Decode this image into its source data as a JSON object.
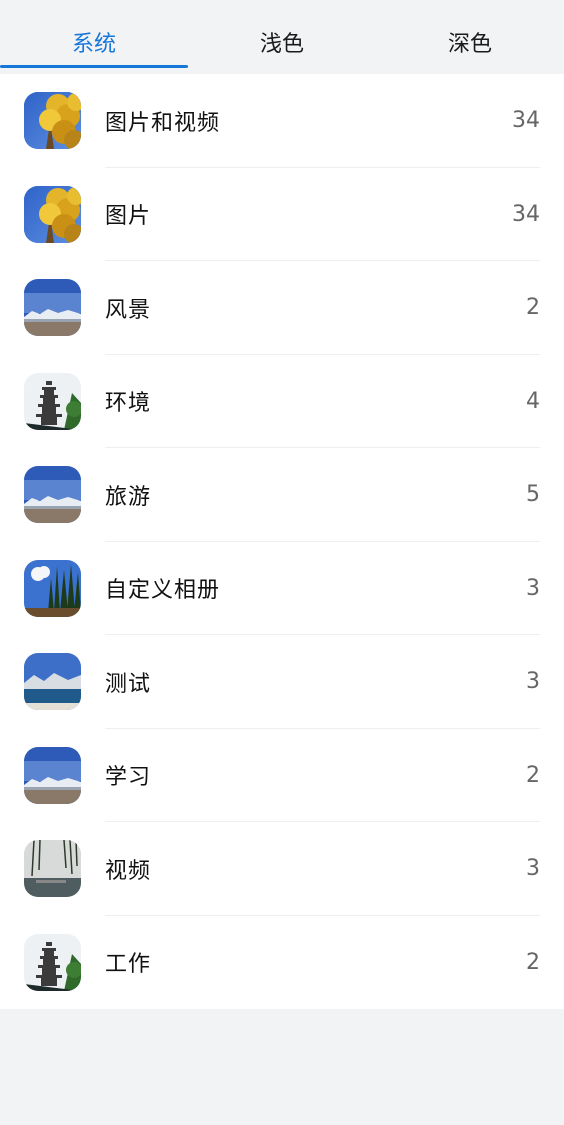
{
  "tabs": [
    {
      "label": "系统",
      "active": true
    },
    {
      "label": "浅色",
      "active": false
    },
    {
      "label": "深色",
      "active": false
    }
  ],
  "colors": {
    "accent": "#1677d9",
    "background": "#f1f3f5",
    "list_background": "#ffffff"
  },
  "albums": [
    {
      "name": "图片和视频",
      "count": "34",
      "thumb": "yellow-tree-sky"
    },
    {
      "name": "图片",
      "count": "34",
      "thumb": "yellow-tree-sky"
    },
    {
      "name": "风景",
      "count": "2",
      "thumb": "snow-mountains"
    },
    {
      "name": "环境",
      "count": "4",
      "thumb": "pagoda"
    },
    {
      "name": "旅游",
      "count": "5",
      "thumb": "snow-mountains"
    },
    {
      "name": "自定义相册",
      "count": "3",
      "thumb": "poplar-trees"
    },
    {
      "name": "测试",
      "count": "3",
      "thumb": "lake-mountains"
    },
    {
      "name": "学习",
      "count": "2",
      "thumb": "snow-mountains"
    },
    {
      "name": "视频",
      "count": "3",
      "thumb": "willow-lake"
    },
    {
      "name": "工作",
      "count": "2",
      "thumb": "pagoda"
    }
  ]
}
